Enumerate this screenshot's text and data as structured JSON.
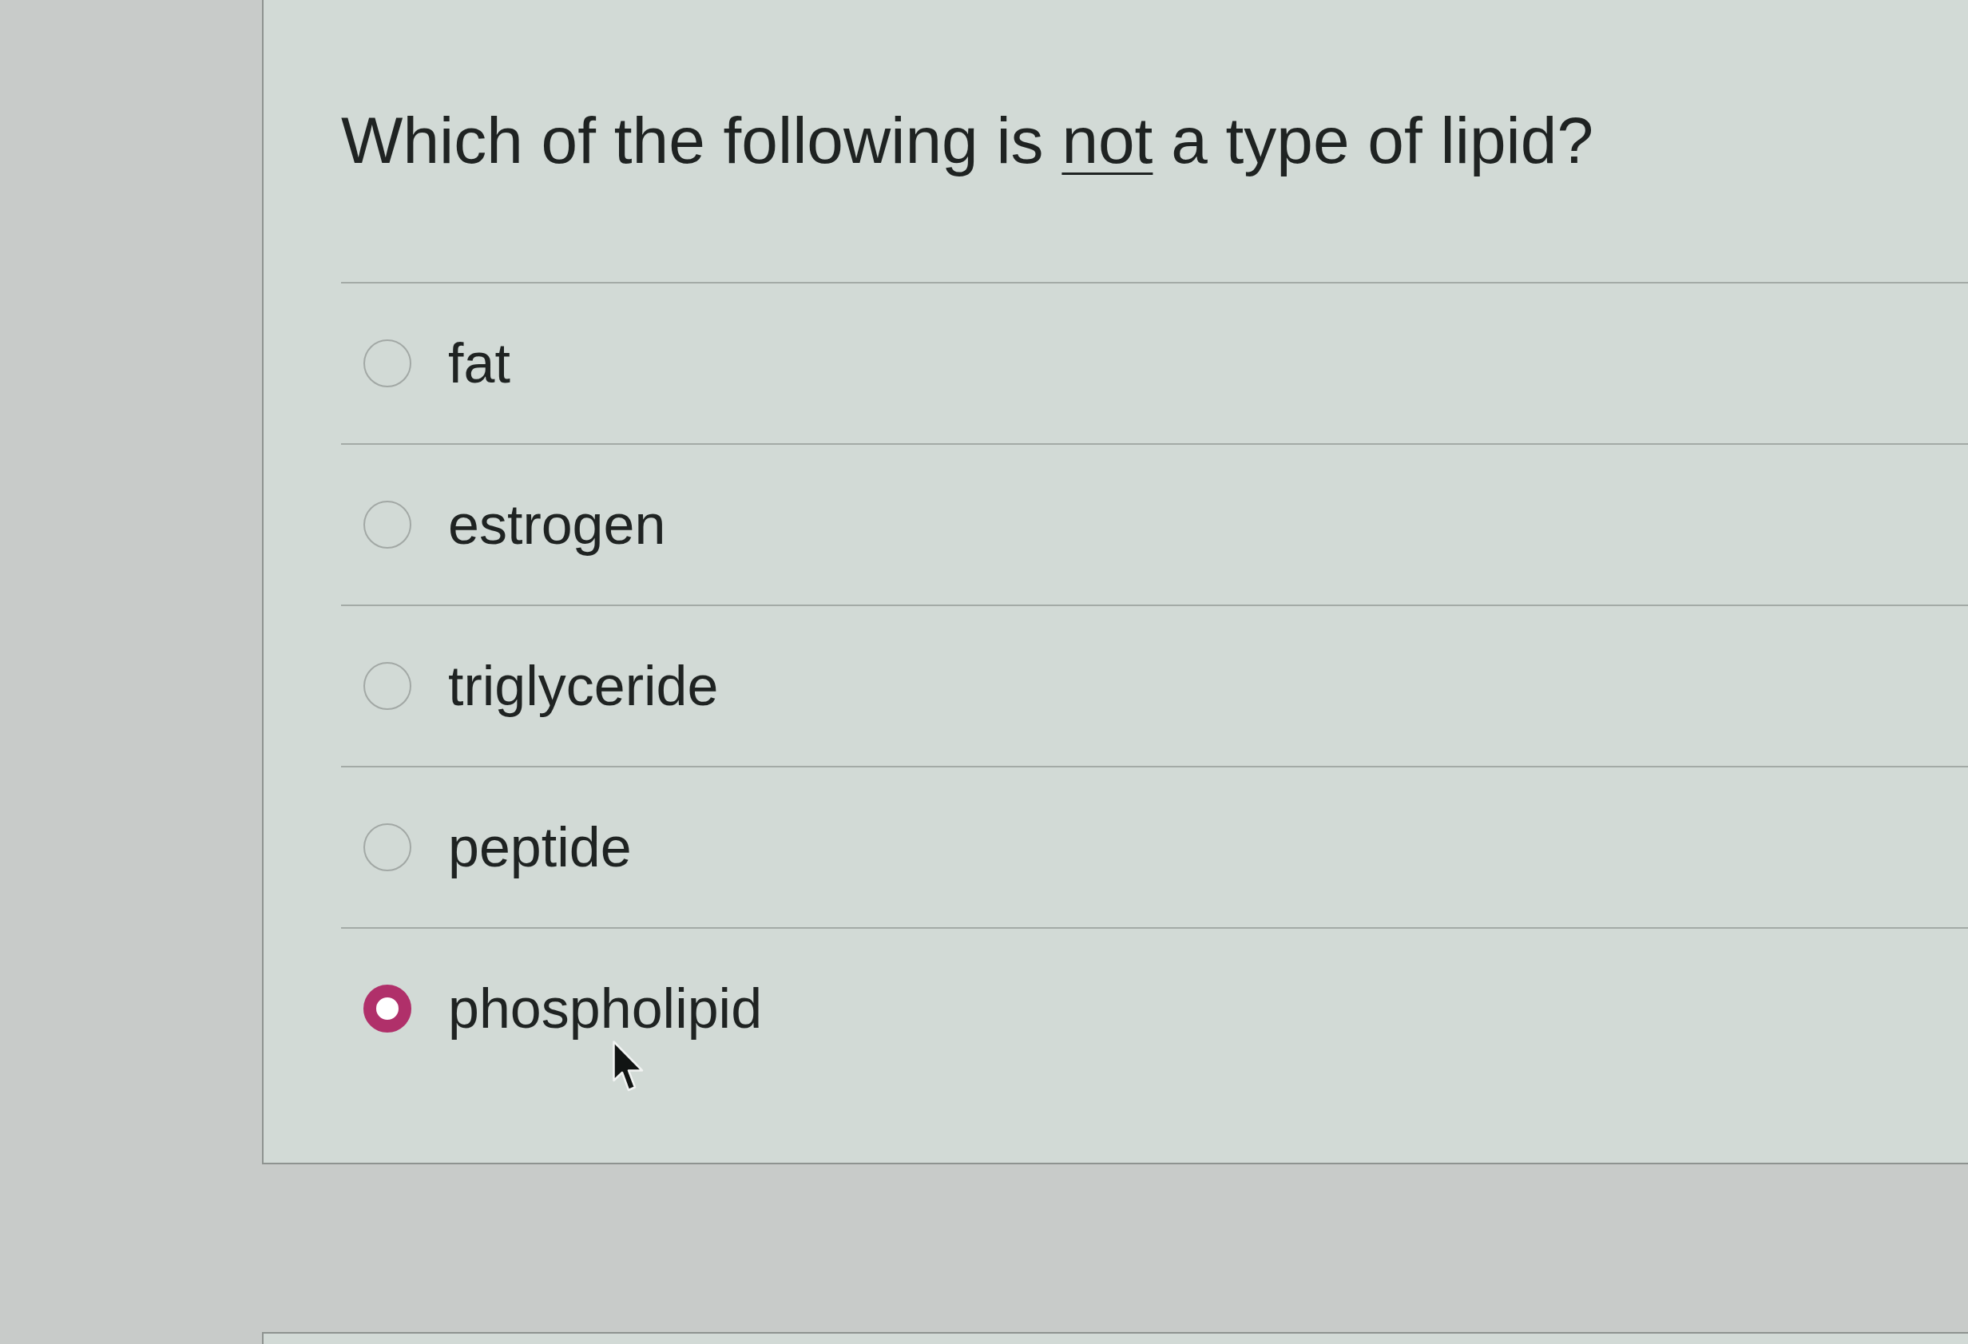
{
  "question": {
    "segments": [
      {
        "text": "Which of the following is ",
        "underlined": false
      },
      {
        "text": "not",
        "underlined": true
      },
      {
        "text": " a type of lipid?",
        "underlined": false
      }
    ]
  },
  "options": [
    {
      "label": "fat",
      "selected": false
    },
    {
      "label": "estrogen",
      "selected": false
    },
    {
      "label": "triglyceride",
      "selected": false
    },
    {
      "label": "peptide",
      "selected": false
    },
    {
      "label": "phospholipid",
      "selected": true
    }
  ]
}
